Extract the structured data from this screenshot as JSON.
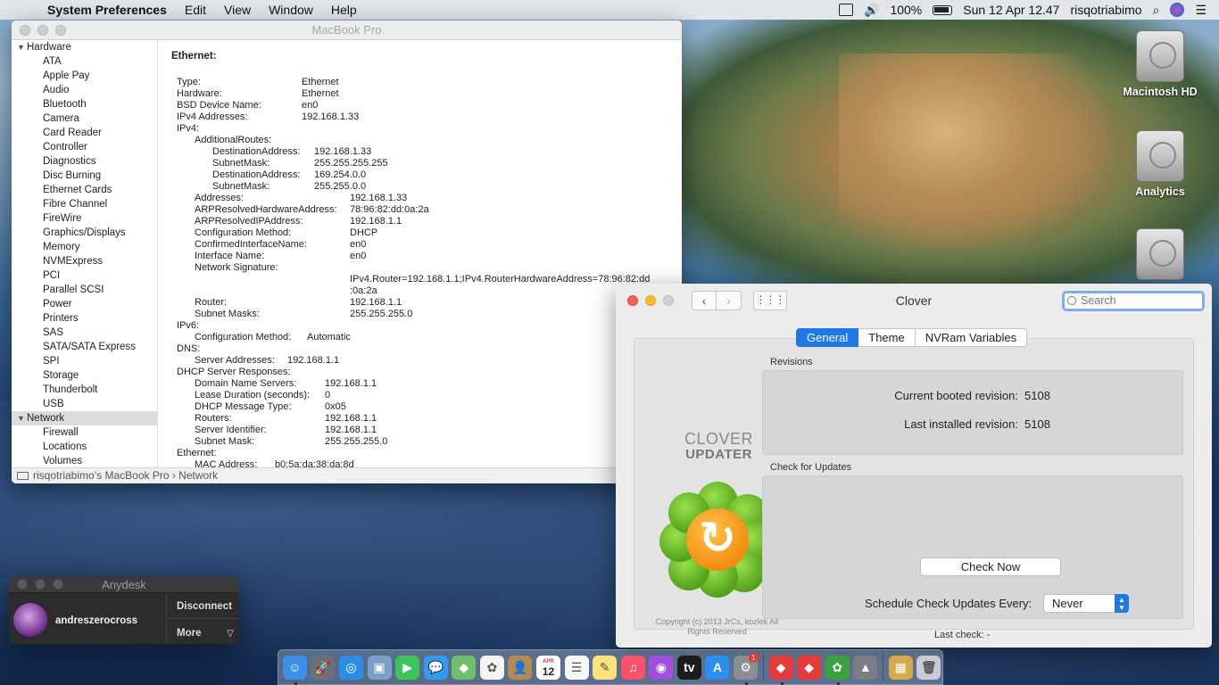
{
  "menubar": {
    "app": "System Preferences",
    "menus": [
      "Edit",
      "View",
      "Window",
      "Help"
    ],
    "battery_percent": "100%",
    "datetime": "Sun 12 Apr  12.47",
    "user": "risqotriabimo"
  },
  "desktop_icons": [
    "Macintosh HD",
    "Analytics",
    ""
  ],
  "sysinfo": {
    "title": "MacBook Pro",
    "sidebar": {
      "hardware_header": "Hardware",
      "hardware_items": [
        "ATA",
        "Apple Pay",
        "Audio",
        "Bluetooth",
        "Camera",
        "Card Reader",
        "Controller",
        "Diagnostics",
        "Disc Burning",
        "Ethernet Cards",
        "Fibre Channel",
        "FireWire",
        "Graphics/Displays",
        "Memory",
        "NVMExpress",
        "PCI",
        "Parallel SCSI",
        "Power",
        "Printers",
        "SAS",
        "SATA/SATA Express",
        "SPI",
        "Storage",
        "Thunderbolt",
        "USB"
      ],
      "network_header": "Network",
      "network_items": [
        "Firewall",
        "Locations",
        "Volumes"
      ]
    },
    "content_title": "Ethernet:",
    "rows": [
      {
        "k": "Type:",
        "v": "Ethernet",
        "i": 0,
        "c": 140
      },
      {
        "k": "Hardware:",
        "v": "Ethernet",
        "i": 0,
        "c": 140
      },
      {
        "k": "BSD Device Name:",
        "v": "en0",
        "i": 0,
        "c": 140
      },
      {
        "k": "IPv4 Addresses:",
        "v": "192.168.1.33",
        "i": 0,
        "c": 140
      },
      {
        "k": "IPv4:",
        "v": "",
        "i": 0,
        "c": 140
      },
      {
        "k": "AdditionalRoutes:",
        "v": "",
        "i": 1,
        "c": 140
      },
      {
        "k": "DestinationAddress:",
        "v": "192.168.1.33",
        "i": 2,
        "c": 154
      },
      {
        "k": "SubnetMask:",
        "v": "255.255.255.255",
        "i": 2,
        "c": 154
      },
      {
        "k": "DestinationAddress:",
        "v": "169.254.0.0",
        "i": 2,
        "c": 154
      },
      {
        "k": "SubnetMask:",
        "v": "255.255.0.0",
        "i": 2,
        "c": 154
      },
      {
        "k": "Addresses:",
        "v": "192.168.1.33",
        "i": 1,
        "c": 194
      },
      {
        "k": "ARPResolvedHardwareAddress:",
        "v": "78:96:82:dd:0a:2a",
        "i": 1,
        "c": 194
      },
      {
        "k": "ARPResolvedIPAddress:",
        "v": "192.168.1.1",
        "i": 1,
        "c": 194
      },
      {
        "k": "Configuration Method:",
        "v": "DHCP",
        "i": 1,
        "c": 194
      },
      {
        "k": "ConfirmedInterfaceName:",
        "v": "en0",
        "i": 1,
        "c": 194
      },
      {
        "k": "Interface Name:",
        "v": "en0",
        "i": 1,
        "c": 194
      },
      {
        "k": "Network Signature:",
        "v": "",
        "i": 1,
        "c": 194
      },
      {
        "k": "",
        "v": "IPv4.Router=192.168.1.1;IPv4.RouterHardwareAddress=78:96:82:dd",
        "i": 1,
        "c": 194
      },
      {
        "k": "",
        "v": ":0a:2a",
        "i": 1,
        "c": 194
      },
      {
        "k": "Router:",
        "v": "192.168.1.1",
        "i": 1,
        "c": 194
      },
      {
        "k": "Subnet Masks:",
        "v": "255.255.255.0",
        "i": 1,
        "c": 194
      },
      {
        "k": "IPv6:",
        "v": "",
        "i": 0,
        "c": 140
      },
      {
        "k": "Configuration Method:",
        "v": "Automatic",
        "i": 1,
        "c": 146
      },
      {
        "k": "DNS:",
        "v": "",
        "i": 0,
        "c": 140
      },
      {
        "k": "Server Addresses:",
        "v": "192.168.1.1",
        "i": 1,
        "c": 124
      },
      {
        "k": "DHCP Server Responses:",
        "v": "",
        "i": 0,
        "c": 140
      },
      {
        "k": "Domain Name Servers:",
        "v": "192.168.1.1",
        "i": 1,
        "c": 166
      },
      {
        "k": "Lease Duration (seconds):",
        "v": "0",
        "i": 1,
        "c": 166
      },
      {
        "k": "DHCP Message Type:",
        "v": "0x05",
        "i": 1,
        "c": 166
      },
      {
        "k": "Routers:",
        "v": "192.168.1.1",
        "i": 1,
        "c": 166
      },
      {
        "k": "Server Identifier:",
        "v": "192.168.1.1",
        "i": 1,
        "c": 166
      },
      {
        "k": "Subnet Mask:",
        "v": "255.255.255.0",
        "i": 1,
        "c": 166
      },
      {
        "k": "Ethernet:",
        "v": "",
        "i": 0,
        "c": 140
      },
      {
        "k": "MAC Address:",
        "v": "b0:5a:da:38:da:8d",
        "i": 1,
        "c": 110
      }
    ],
    "breadcrumb": "risqotriabimo’s MacBook Pro › Network"
  },
  "clover": {
    "title": "Clover",
    "search_placeholder": "Search",
    "tabs": [
      "General",
      "Theme",
      "NVRam Variables"
    ],
    "active_tab": 0,
    "logo_line1": "CLOVER",
    "logo_line2": "UPDATER",
    "copyright": "Copyright (c) 2013 JrCs, kozlek All Rights Reserved",
    "revisions_label": "Revisions",
    "current_label": "Current booted revision:",
    "current_value": "5108",
    "installed_label": "Last installed revision:",
    "installed_value": "5108",
    "updates_label": "Check for Updates",
    "check_now": "Check Now",
    "schedule_label": "Schedule Check Updates Every:",
    "schedule_value": "Never",
    "last_check": "Last check: -"
  },
  "anydesk": {
    "title": "Anydesk",
    "user": "andreszerocross",
    "disconnect": "Disconnect",
    "more": "More"
  },
  "dock": {
    "calendar_day": "12",
    "calendar_month": "APR",
    "badge": "1",
    "apps": [
      {
        "name": "finder",
        "color": "#3d8fe8",
        "glyph": "☺",
        "run": true
      },
      {
        "name": "launchpad",
        "color": "#6b6f78",
        "glyph": "🚀",
        "run": false
      },
      {
        "name": "safari",
        "color": "#2b8ee6",
        "glyph": "◎",
        "run": false
      },
      {
        "name": "preview",
        "color": "#7aa0c8",
        "glyph": "▣",
        "run": false
      },
      {
        "name": "facetime",
        "color": "#3cc45a",
        "glyph": "▶",
        "run": false
      },
      {
        "name": "messages",
        "color": "#2f9bf2",
        "glyph": "💬",
        "run": false
      },
      {
        "name": "maps",
        "color": "#6fc06a",
        "glyph": "◆",
        "run": false
      },
      {
        "name": "photos",
        "color": "#f4f4f4",
        "glyph": "✿",
        "run": false
      },
      {
        "name": "contacts",
        "color": "#b58a52",
        "glyph": "👤",
        "run": false
      },
      {
        "name": "calendar",
        "color": "#ffffff",
        "glyph": "12",
        "run": false
      },
      {
        "name": "reminders",
        "color": "#f7f7f7",
        "glyph": "☰",
        "run": false
      },
      {
        "name": "notes",
        "color": "#fbe27a",
        "glyph": "✎",
        "run": false
      },
      {
        "name": "music",
        "color": "#fb4f6a",
        "glyph": "♫",
        "run": false
      },
      {
        "name": "podcasts",
        "color": "#a24ee0",
        "glyph": "◉",
        "run": false
      },
      {
        "name": "tv",
        "color": "#1b1b1b",
        "glyph": "tv",
        "run": false
      },
      {
        "name": "app-store",
        "color": "#2a8ff0",
        "glyph": "A",
        "run": false
      },
      {
        "name": "system-preferences",
        "color": "#8a8d94",
        "glyph": "⚙",
        "run": true
      }
    ],
    "apps2": [
      {
        "name": "anydesk",
        "color": "#e8393b",
        "glyph": "◆",
        "run": true
      },
      {
        "name": "anydesk-alt",
        "color": "#e8393b",
        "glyph": "◆",
        "run": false
      },
      {
        "name": "clover",
        "color": "#3aa13c",
        "glyph": "✿",
        "run": true
      },
      {
        "name": "migration",
        "color": "#7a7d84",
        "glyph": "▲",
        "run": false
      }
    ],
    "apps3": [
      {
        "name": "archive",
        "color": "#d8a94a",
        "glyph": "▦",
        "run": false
      },
      {
        "name": "trash",
        "color": "#c9ccd2",
        "glyph": "🗑",
        "run": false
      }
    ]
  }
}
